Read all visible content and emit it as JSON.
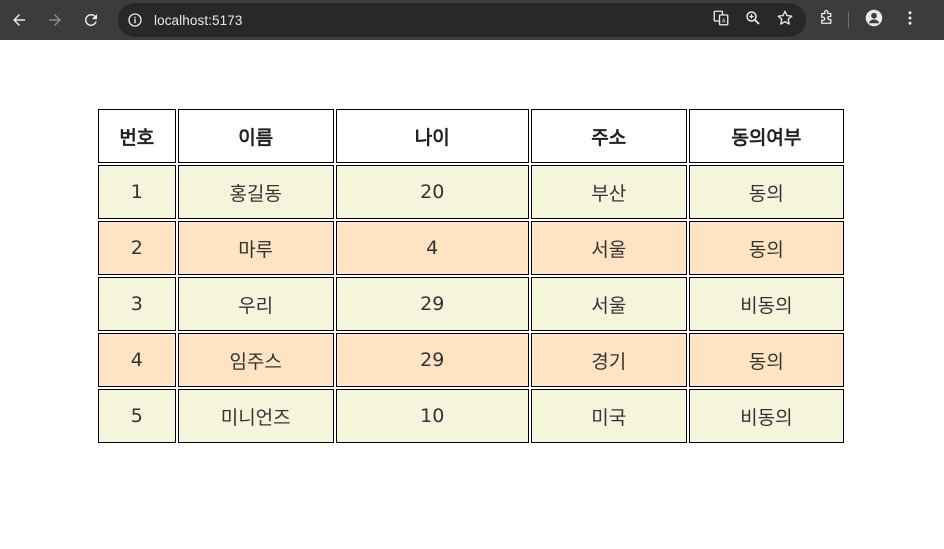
{
  "browser": {
    "url": "localhost:5173",
    "colors": {
      "toolbar": "#3c3c3c",
      "omnibox": "#282828",
      "text": "#e8eaed"
    }
  },
  "table": {
    "headers": [
      "번호",
      "이름",
      "나이",
      "주소",
      "동의여부"
    ],
    "rows": [
      [
        "1",
        "홍길동",
        "20",
        "부산",
        "동의"
      ],
      [
        "2",
        "마루",
        "4",
        "서울",
        "동의"
      ],
      [
        "3",
        "우리",
        "29",
        "서울",
        "비동의"
      ],
      [
        "4",
        "임주스",
        "29",
        "경기",
        "동의"
      ],
      [
        "5",
        "미니언즈",
        "10",
        "미국",
        "비동의"
      ]
    ],
    "colors": {
      "odd_row": "#f5f5dc",
      "even_row": "#ffe4c4",
      "border": "#000000"
    }
  }
}
